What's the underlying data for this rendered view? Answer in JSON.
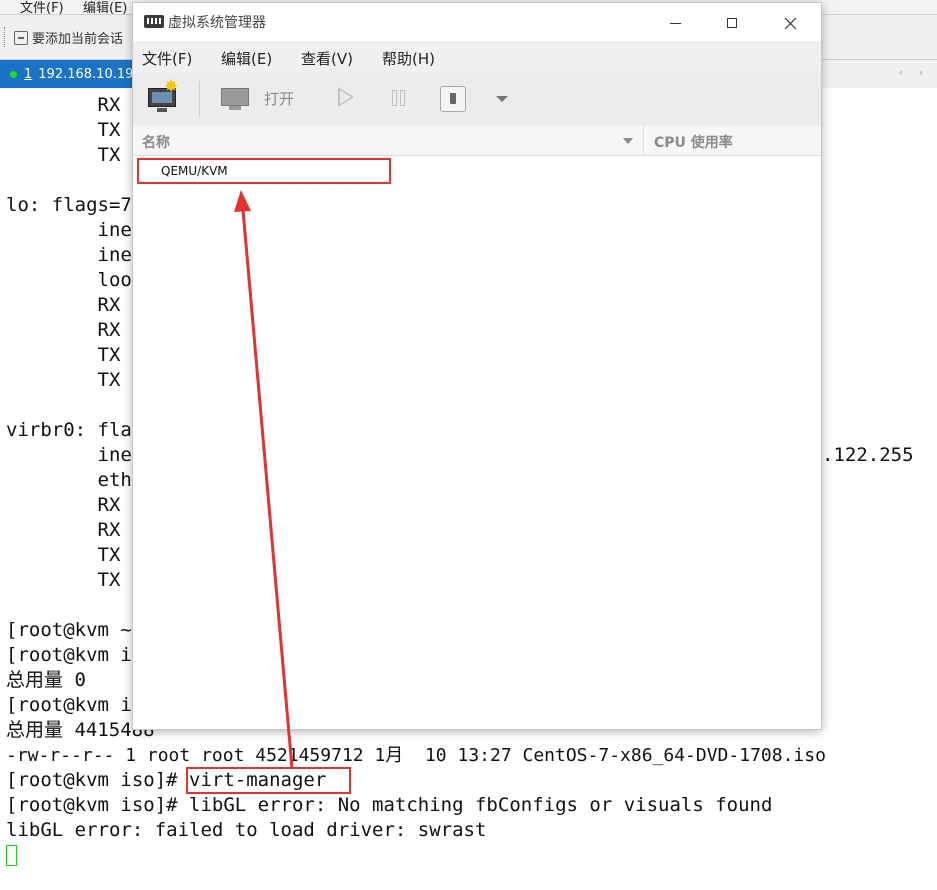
{
  "host_menubar": [
    "文件(F)",
    "编辑(E)"
  ],
  "host_toolbar": {
    "session_hint": "要添加当前会话"
  },
  "session_tab": {
    "number": "1",
    "host": "192.168.10.19"
  },
  "terminal": {
    "lines": [
      "        RX",
      "        TX",
      "        TX",
      "",
      "lo: flags=7",
      "        ine",
      "        ine",
      "        loo",
      "        RX",
      "        RX",
      "        TX",
      "        TX",
      "",
      "virbr0: fla",
      "        ine",
      "        eth",
      "        RX",
      "        RX",
      "        TX",
      "        TX",
      "",
      "[root@kvm ~",
      "[root@kvm i",
      "总用量 0",
      "[root@kvm i",
      "总用量 4415488",
      "-rw-r--r-- 1 root root 4521459712 1月  10 13:27 CentOS-7-x86_64-DVD-1708.iso",
      "[root@kvm iso]# virt-manager",
      "[root@kvm iso]# libGL error: No matching fbConfigs or visuals found",
      "libGL error: failed to load driver: swrast"
    ],
    "overflow_fragment": ".122.255"
  },
  "dialog": {
    "title": "虚拟系统管理器",
    "menu": [
      "文件(F)",
      "编辑(E)",
      "查看(V)",
      "帮助(H)"
    ],
    "toolbar": {
      "open_label": "打开"
    },
    "columns": {
      "name": "名称",
      "cpu": "CPU 使用率"
    },
    "connection": "QEMU/KVM"
  },
  "colors": {
    "highlight": "#e23232",
    "tab_active": "#1a73c9",
    "cursor": "#22cc22"
  }
}
